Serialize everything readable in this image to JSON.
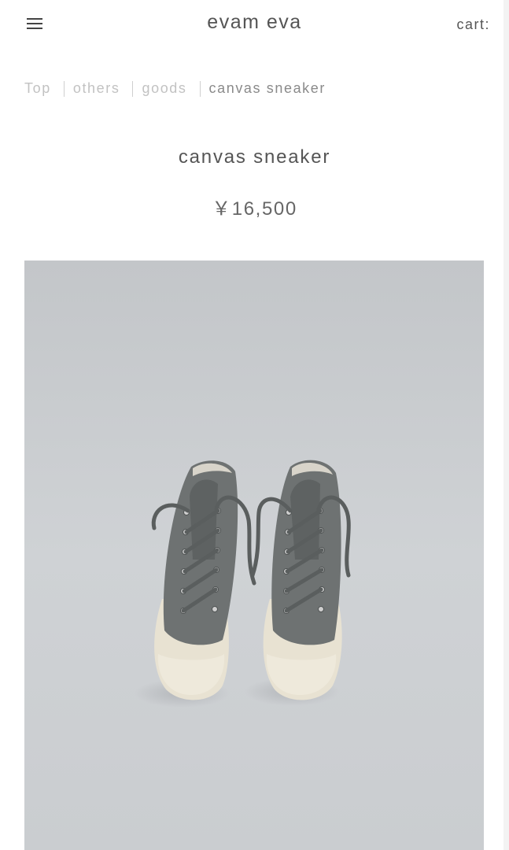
{
  "header": {
    "menu_icon": "hamburger-menu-icon",
    "brand": "evam eva",
    "cart_label": "cart:"
  },
  "breadcrumb": [
    {
      "label": "Top"
    },
    {
      "label": "others"
    },
    {
      "label": "goods"
    },
    {
      "label": "canvas sneaker"
    }
  ],
  "product": {
    "name": "canvas sneaker",
    "price": "￥16,500",
    "image_alt": "canvas-sneaker-pair-photo"
  },
  "colors": {
    "text": "#555555",
    "breadcrumb_inactive": "#c2c2c2",
    "breadcrumb_current": "#8a8a8a",
    "photo_background": "#c9ccd0",
    "shoe_upper": "#6b6f6f",
    "shoe_sole": "#e9e4d6"
  }
}
